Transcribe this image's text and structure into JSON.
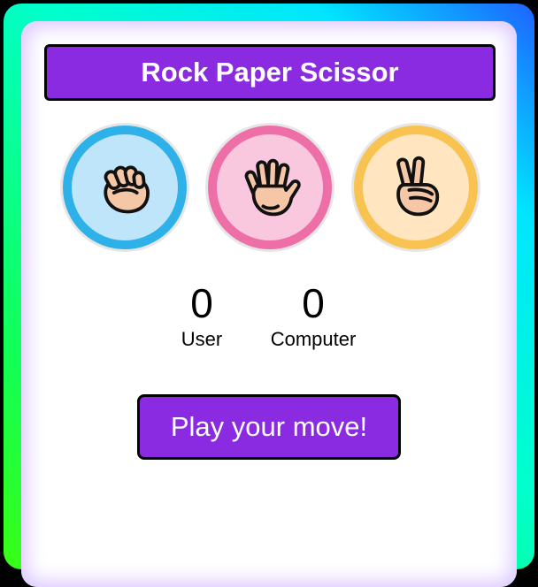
{
  "title": "Rock Paper Scissor",
  "choices": [
    {
      "id": "rock",
      "icon": "rock-fist-icon",
      "ring_color": "#2eb1e8",
      "fill_color": "#bfe5fb"
    },
    {
      "id": "paper",
      "icon": "paper-hand-icon",
      "ring_color": "#ee6fa8",
      "fill_color": "#f9c8de"
    },
    {
      "id": "scissors",
      "icon": "scissors-hand-icon",
      "ring_color": "#f8c351",
      "fill_color": "#ffe6c0"
    }
  ],
  "score": {
    "user_value": "0",
    "user_label": "User",
    "computer_value": "0",
    "computer_label": "Computer"
  },
  "message": "Play your move!",
  "colors": {
    "accent": "#8a2be2",
    "skin": "#f6c7a6"
  }
}
